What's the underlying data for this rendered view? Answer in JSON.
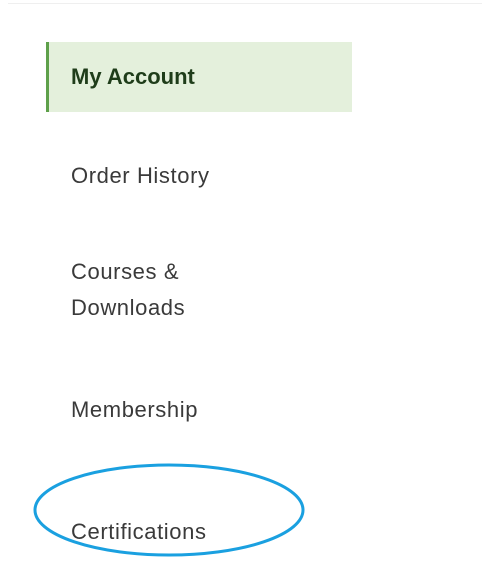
{
  "nav": {
    "items": [
      {
        "label": "My Account",
        "active": true
      },
      {
        "label": "Order History",
        "active": false
      },
      {
        "label": "Courses & Downloads",
        "active": false
      },
      {
        "label": "Membership",
        "active": false
      },
      {
        "label": "Certifications",
        "active": false
      }
    ]
  },
  "colors": {
    "active_bg": "#e4f0dc",
    "active_border": "#5ea04a",
    "text": "#3a3a3a",
    "highlight_ellipse": "#1aa0e0"
  }
}
